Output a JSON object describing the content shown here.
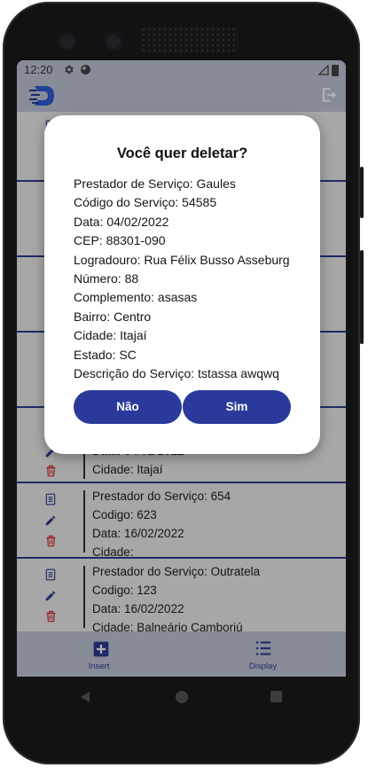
{
  "status": {
    "time": "12:20"
  },
  "list": {
    "rows": [
      {
        "line1": "Data: 04/02/2022",
        "line2": "Cidade: Itajaí"
      },
      {
        "line1": "Prestador do Serviço: 654",
        "line2": "Codigo: 623",
        "line3": "Data: 16/02/2022",
        "line4": "Cidade:"
      },
      {
        "line1": "Prestador do Serviço: Outratela",
        "line2": "Codigo: 123",
        "line3": "Data: 16/02/2022",
        "line4": "Cidade: Balneário Camboriú"
      }
    ]
  },
  "bottom_nav": {
    "insert_label": "Insert",
    "display_label": "Display"
  },
  "dialog": {
    "title": "Você quer deletar?",
    "lines": [
      "Prestador de Serviço: Gaules",
      "Código do Serviço: 54585",
      "Data: 04/02/2022",
      "CEP: 88301-090",
      "Logradouro: Rua Félix Busso Asseburg",
      "Número: 88",
      "Complemento: asasas",
      "Bairro: Centro",
      "Cidade: Itajaí",
      "Estado: SC",
      "Descrição do Serviço: tstassa awqwq"
    ],
    "no_label": "Não",
    "yes_label": "Sim"
  },
  "colors": {
    "accent": "#2b3a9a",
    "delete": "#d8383a",
    "bars": "#c3c8da"
  },
  "icons": [
    "gear-icon",
    "notification-icon",
    "signal-icon",
    "app-logo-icon",
    "logout-icon",
    "document-icon",
    "edit-icon",
    "trash-icon",
    "add-box-icon",
    "list-icon",
    "back-nav-icon",
    "home-nav-icon",
    "recents-nav-icon"
  ]
}
